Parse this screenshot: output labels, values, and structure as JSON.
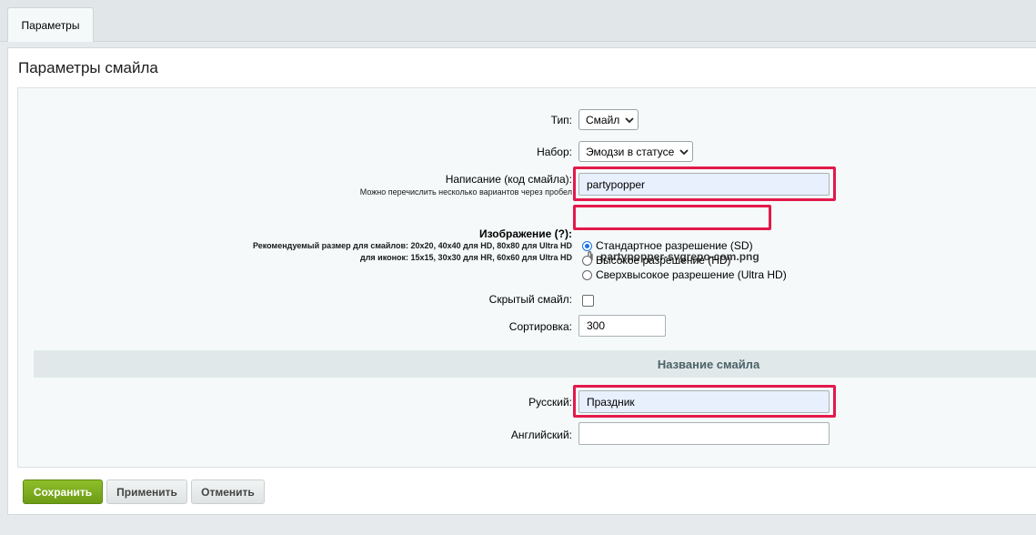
{
  "tabs": [
    {
      "label": "Параметры"
    }
  ],
  "panel": {
    "title": "Параметры смайла"
  },
  "form": {
    "type": {
      "label": "Тип:",
      "value": "Смайл"
    },
    "set": {
      "label": "Набор:",
      "value": "Эмодзи в статусе"
    },
    "typing": {
      "label": "Написание (код смайла):",
      "hint": "Можно перечислить несколько вариантов через пробел",
      "value": "partypopper"
    },
    "image": {
      "label": "Изображение (?):",
      "hint1": "Рекомендуемый размер для смайлов: 20x20, 40x40 для HD, 80x80 для Ultra HD",
      "hint2": "для иконок: 15x15, 30x30 для HR, 60x60 для Ultra HD",
      "file": "partypopper-svgrepo-com.png",
      "resolutions": [
        "Стандартное разрешение (SD)",
        "Высокое разрешение (HD)",
        "Сверхвысокое разрешение (Ultra HD)"
      ],
      "selected_resolution": "Стандартное разрешение (SD)"
    },
    "hidden": {
      "label": "Скрытый смайл:",
      "checked": false
    },
    "sort": {
      "label": "Сортировка:",
      "value": "300"
    },
    "name_section": {
      "title": "Название смайла"
    },
    "russian": {
      "label": "Русский:",
      "value": "Праздник"
    },
    "english": {
      "label": "Английский:",
      "value": ""
    }
  },
  "buttons": {
    "save": "Сохранить",
    "apply": "Применить",
    "cancel": "Отменить"
  },
  "colors": {
    "highlight": "#e4194a",
    "save": "#7aac1c"
  }
}
